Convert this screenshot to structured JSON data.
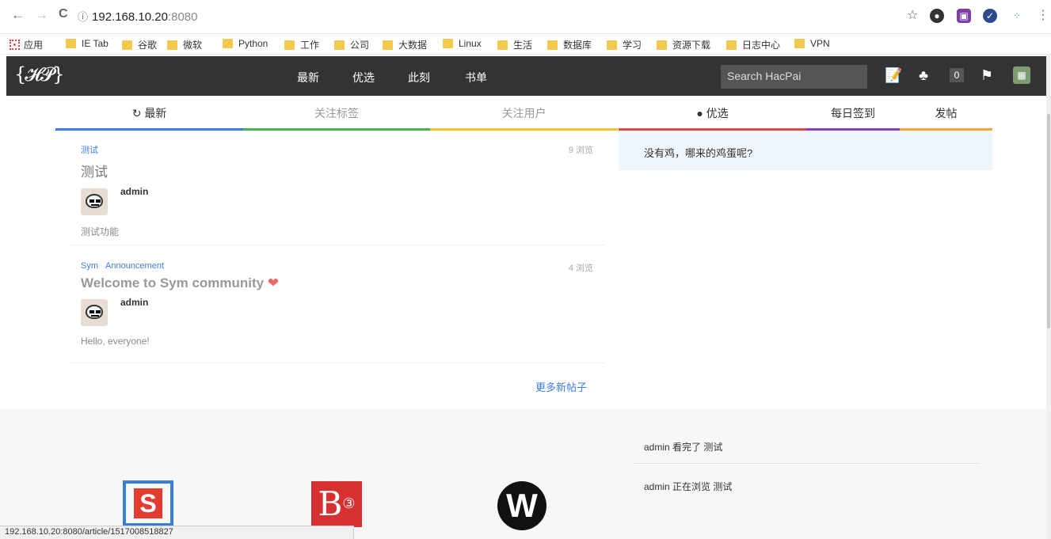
{
  "browser": {
    "back": "←",
    "forward": "→",
    "reload": "C",
    "url_host": "192.168.10.20",
    "url_port": ":8080",
    "status_url": "192.168.10.20:8080/article/1517008518827"
  },
  "bookmarks": [
    "应用",
    "IE Tab",
    "谷歌",
    "微软",
    "Python",
    "工作",
    "公司",
    "大数据",
    "Linux",
    "生活",
    "数据库",
    "学习",
    "资源下载",
    "日志中心",
    "VPN"
  ],
  "header": {
    "logo": "{𝓗𝓟}",
    "nav": [
      "最新",
      "优选",
      "此刻",
      "书单"
    ],
    "search_placeholder": "Search HacPai",
    "notification_count": "0"
  },
  "tabs": [
    "最新",
    "关注标签",
    "关注用户",
    "优选",
    "每日签到",
    "发帖"
  ],
  "articles": [
    {
      "tags": [
        "测试"
      ],
      "views": "9 浏览",
      "title": "测试",
      "author": "admin",
      "preview": "测试功能"
    },
    {
      "tags": [
        "Sym",
        "Announcement"
      ],
      "views": "4 浏览",
      "title": "Welcome to Sym community",
      "author": "admin",
      "preview": "Hello, everyone!"
    }
  ],
  "more_posts": "更多新帖子",
  "notice": "没有鸡，哪来的鸡蛋呢?",
  "activities": [
    "admin 看完了 测试",
    "admin 正在浏览 测试"
  ],
  "colors": {
    "tab_1": "#3b7de1",
    "tab_2": "#4caf50",
    "tab_3": "#f3c623",
    "tab_4": "#d94d4d",
    "tab_5": "#8a3fbf",
    "tab_6": "#f0a640"
  }
}
